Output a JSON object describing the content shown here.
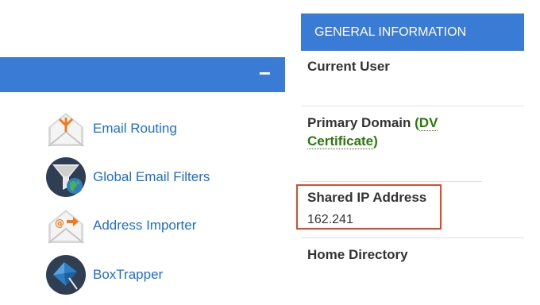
{
  "email_section": {
    "collapse_label": "−",
    "items": [
      {
        "label": "Email Routing",
        "icon": "email-routing-icon"
      },
      {
        "label": "Global Email Filters",
        "icon": "global-email-filters-icon"
      },
      {
        "label": "Address Importer",
        "icon": "address-importer-icon"
      },
      {
        "label": "BoxTrapper",
        "icon": "boxtrapper-icon"
      }
    ]
  },
  "general_info": {
    "title": "GENERAL INFORMATION",
    "current_user": {
      "label": "Current User"
    },
    "primary_domain": {
      "label": "Primary Domain",
      "open_paren": "(",
      "cert_label": "DV Certificate",
      "close_paren": ")"
    },
    "shared_ip": {
      "label": "Shared IP Address",
      "value": "162.241"
    },
    "home_directory": {
      "label": "Home Directory"
    }
  },
  "colors": {
    "header_blue": "#3a7bd5",
    "link_blue": "#1f6fcf",
    "cert_green": "#2b7a0b",
    "highlight_red": "#e24a2c"
  }
}
